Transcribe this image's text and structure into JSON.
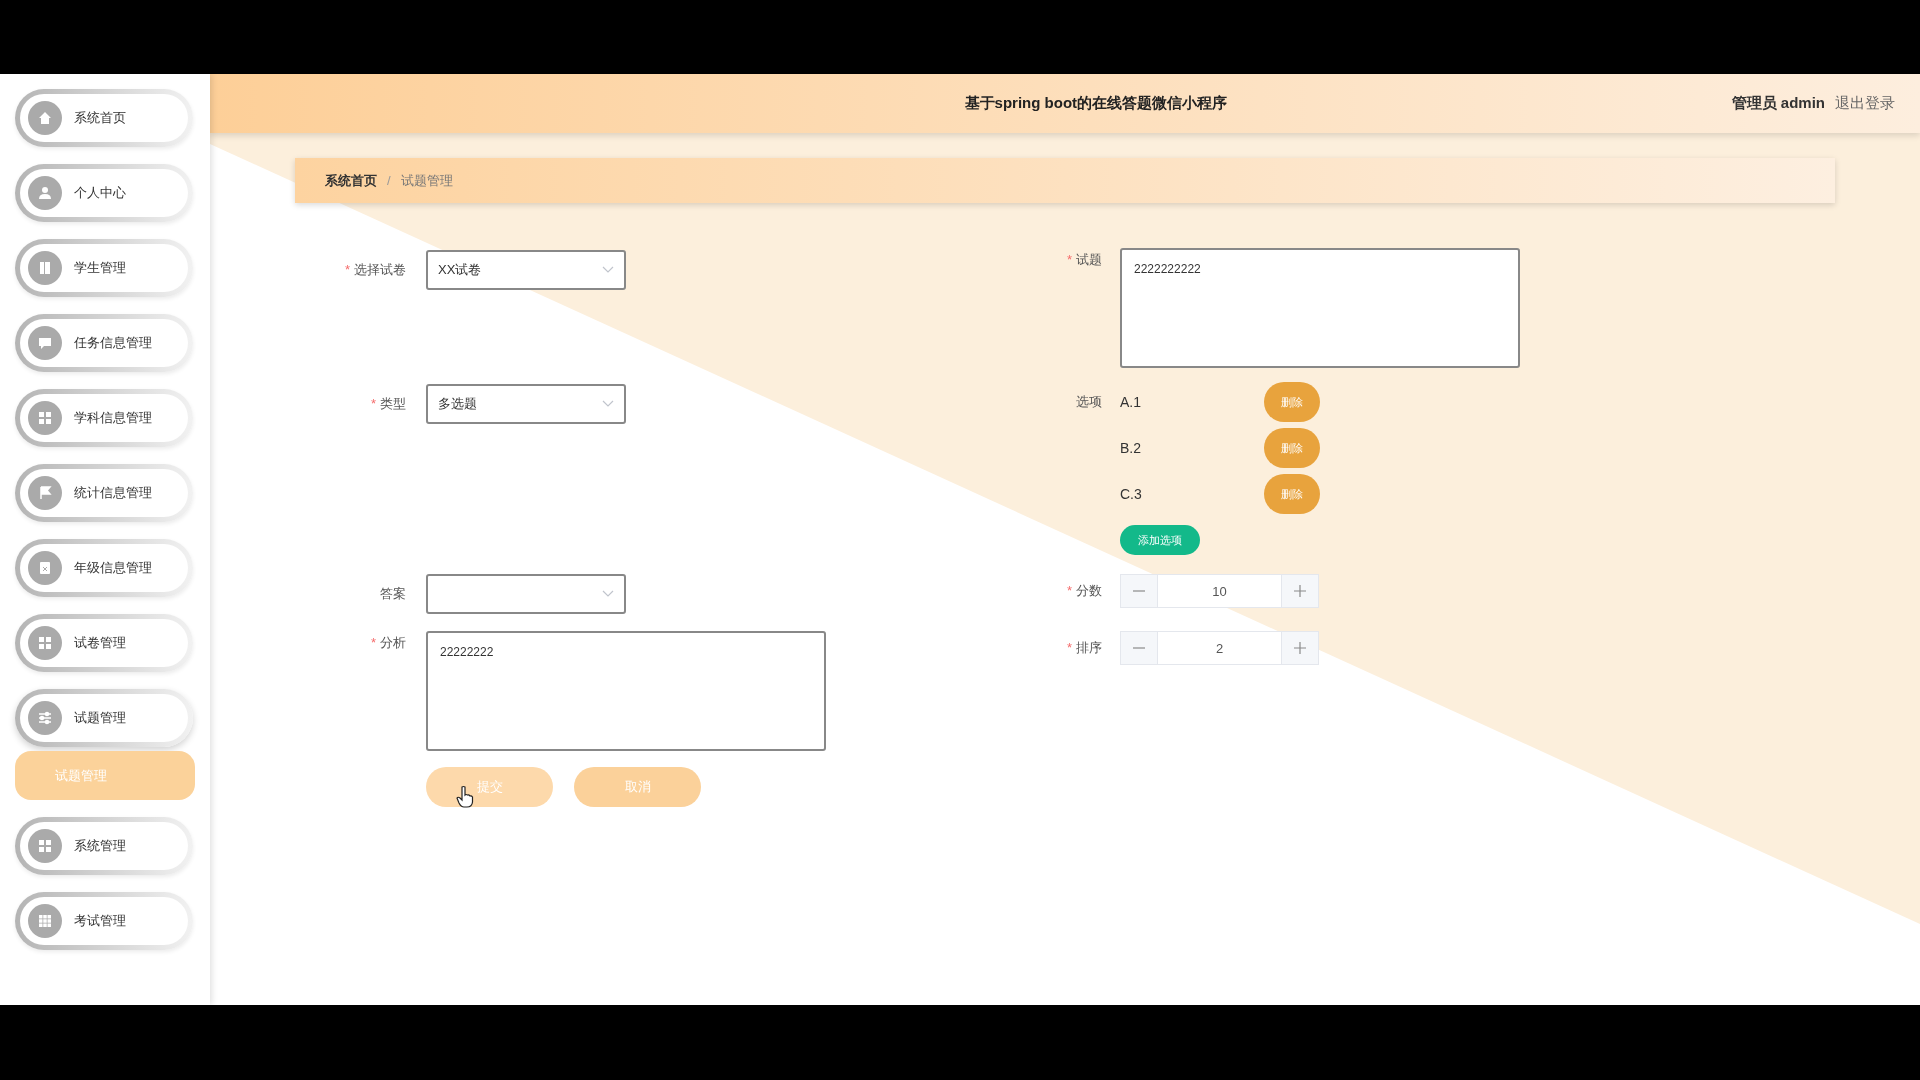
{
  "header": {
    "title": "基于spring boot的在线答题微信小程序",
    "user": "管理员 admin",
    "logout": "退出登录"
  },
  "sidebar": {
    "items": [
      {
        "label": "系统首页",
        "selected": false
      },
      {
        "label": "个人中心",
        "selected": false
      },
      {
        "label": "学生管理",
        "selected": false
      },
      {
        "label": "任务信息管理",
        "selected": false
      },
      {
        "label": "学科信息管理",
        "selected": false
      },
      {
        "label": "统计信息管理",
        "selected": false
      },
      {
        "label": "年级信息管理",
        "selected": false
      },
      {
        "label": "试卷管理",
        "selected": false
      },
      {
        "label": "试题管理",
        "selected": false,
        "expanded": true,
        "children": [
          {
            "label": "试题管理",
            "selected": true
          }
        ]
      },
      {
        "label": "系统管理",
        "selected": false
      },
      {
        "label": "考试管理",
        "selected": false
      }
    ]
  },
  "breadcrumb": {
    "separator": "/",
    "items": [
      {
        "label": "系统首页",
        "current": false
      },
      {
        "label": "试题管理",
        "current": true
      }
    ]
  },
  "form": {
    "required_mark": "*",
    "left": [
      {
        "kind": "select",
        "label": "选择试卷",
        "required": true,
        "value": "XX试卷"
      },
      {
        "kind": "select",
        "label": "类型",
        "required": true,
        "value": "多选题"
      },
      {
        "kind": "select",
        "label": "答案",
        "required": false
      },
      {
        "kind": "textarea",
        "label": "分析",
        "required": true,
        "value": "22222222"
      }
    ],
    "right": [
      {
        "kind": "textarea",
        "label": "试题",
        "required": true,
        "value": "2222222222"
      },
      {
        "kind": "options",
        "label": "选项",
        "required": false,
        "items": [
          {
            "text": "A.1",
            "action": "删除"
          },
          {
            "text": "B.2",
            "action": "删除"
          },
          {
            "text": "C.3",
            "action": "删除"
          }
        ],
        "add_button": "添加选项"
      },
      {
        "kind": "number",
        "label": "分数",
        "required": true,
        "value": "10"
      },
      {
        "kind": "number",
        "label": "排序",
        "required": true,
        "value": "2"
      }
    ],
    "buttons": [
      {
        "label": "提交",
        "hovered": true
      },
      {
        "label": "取消",
        "hovered": false
      }
    ]
  }
}
